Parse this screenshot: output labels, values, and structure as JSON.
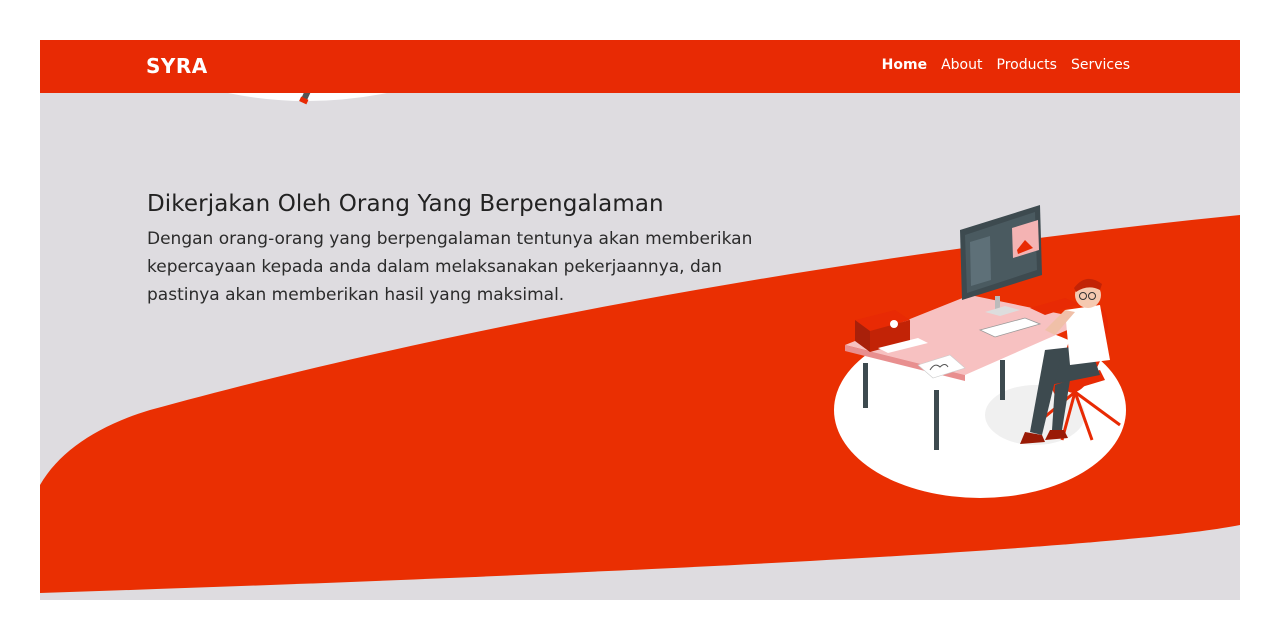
{
  "navbar": {
    "brand": "SYRA",
    "links": [
      {
        "label": "Home",
        "active": true
      },
      {
        "label": "About",
        "active": false
      },
      {
        "label": "Products",
        "active": false
      },
      {
        "label": "Services",
        "active": false
      }
    ]
  },
  "hero": {
    "headline": "Dikerjakan Oleh Orang Yang Berpengalaman",
    "description": "Dengan orang-orang yang berpengalaman tentunya akan memberikan kepercayaan kepada anda dalam melaksanakan pekerjaannya, dan pastinya akan memberikan hasil yang maksimal.",
    "illustration": "person-working-at-desk-illustration"
  },
  "colors": {
    "accent": "#e82a04",
    "background": "#dedce0",
    "text": "#222222"
  }
}
